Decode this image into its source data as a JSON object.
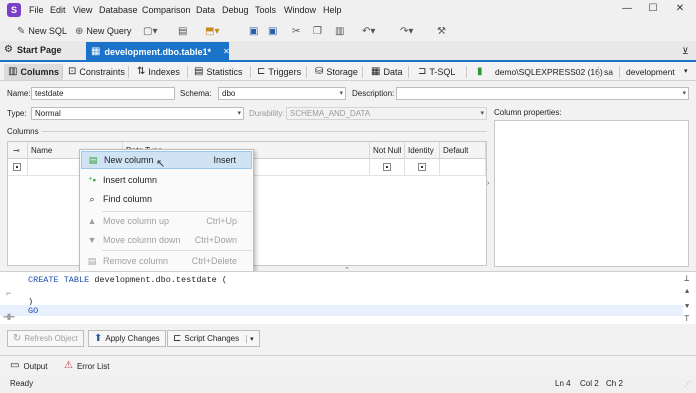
{
  "app": {
    "logo": "S"
  },
  "menu": [
    "File",
    "Edit",
    "View",
    "Database",
    "Comparison",
    "Data",
    "Debug",
    "Tools",
    "Window",
    "Help"
  ],
  "window_controls": {
    "minimize": "—",
    "maximize": "☐",
    "close": "✕"
  },
  "toolbar": {
    "new_sql": "New SQL",
    "new_query": "New Query"
  },
  "doc_tabs": {
    "start": "Start Page",
    "doc": "development.dbo.table1*"
  },
  "design_tabs": [
    "Columns",
    "Constraints",
    "Indexes",
    "Statistics",
    "Triggers",
    "Storage",
    "Data",
    "T-SQL"
  ],
  "connection": {
    "server": "demo\\SQLEXPRESS02 (16)",
    "user": "sa",
    "database": "development"
  },
  "form": {
    "name_label": "Name:",
    "name_value": "testdate",
    "schema_label": "Schema:",
    "schema_value": "dbo",
    "description_label": "Description:",
    "description_value": "",
    "type_label": "Type:",
    "type_value": "Normal",
    "durability_label": "Durability:",
    "durability_value": "SCHEMA_AND_DATA",
    "columns_label": "Columns",
    "column_properties_label": "Column properties:"
  },
  "grid": {
    "headers": {
      "key": "⊸",
      "name": "Name",
      "datatype": "Data Type",
      "not_null": "Not Null",
      "identity": "Identity",
      "default": "Default"
    }
  },
  "context_menu": [
    {
      "icon": "new-column-icon",
      "label": "New column",
      "shortcut": "Insert",
      "disabled": false,
      "highlighted": true
    },
    {
      "icon": "insert-column-icon",
      "label": "Insert column",
      "shortcut": "",
      "disabled": false
    },
    {
      "icon": "find-column-icon",
      "label": "Find column",
      "shortcut": "",
      "disabled": false
    },
    {
      "icon": "move-up-icon",
      "label": "Move column up",
      "shortcut": "Ctrl+Up",
      "disabled": true
    },
    {
      "icon": "move-down-icon",
      "label": "Move column down",
      "shortcut": "Ctrl+Down",
      "disabled": true
    },
    {
      "icon": "remove-column-icon",
      "label": "Remove column",
      "shortcut": "Ctrl+Delete",
      "disabled": true
    }
  ],
  "sql": {
    "line1": "CREATE TABLE development.dbo.testdate (",
    "line2": "",
    "line3": ")",
    "line4": "GO"
  },
  "buttons": {
    "refresh": "Refresh Object",
    "apply": "Apply Changes",
    "script": "Script Changes"
  },
  "output_tabs": {
    "output": "Output",
    "errors": "Error List"
  },
  "status": {
    "text": "Ready",
    "ln": "Ln 4",
    "col": "Col 2",
    "ch": "Ch 2"
  },
  "colors": {
    "accent": "#1a73c8",
    "logo": "#7a3fc7",
    "highlight": "#cfe3f5"
  }
}
